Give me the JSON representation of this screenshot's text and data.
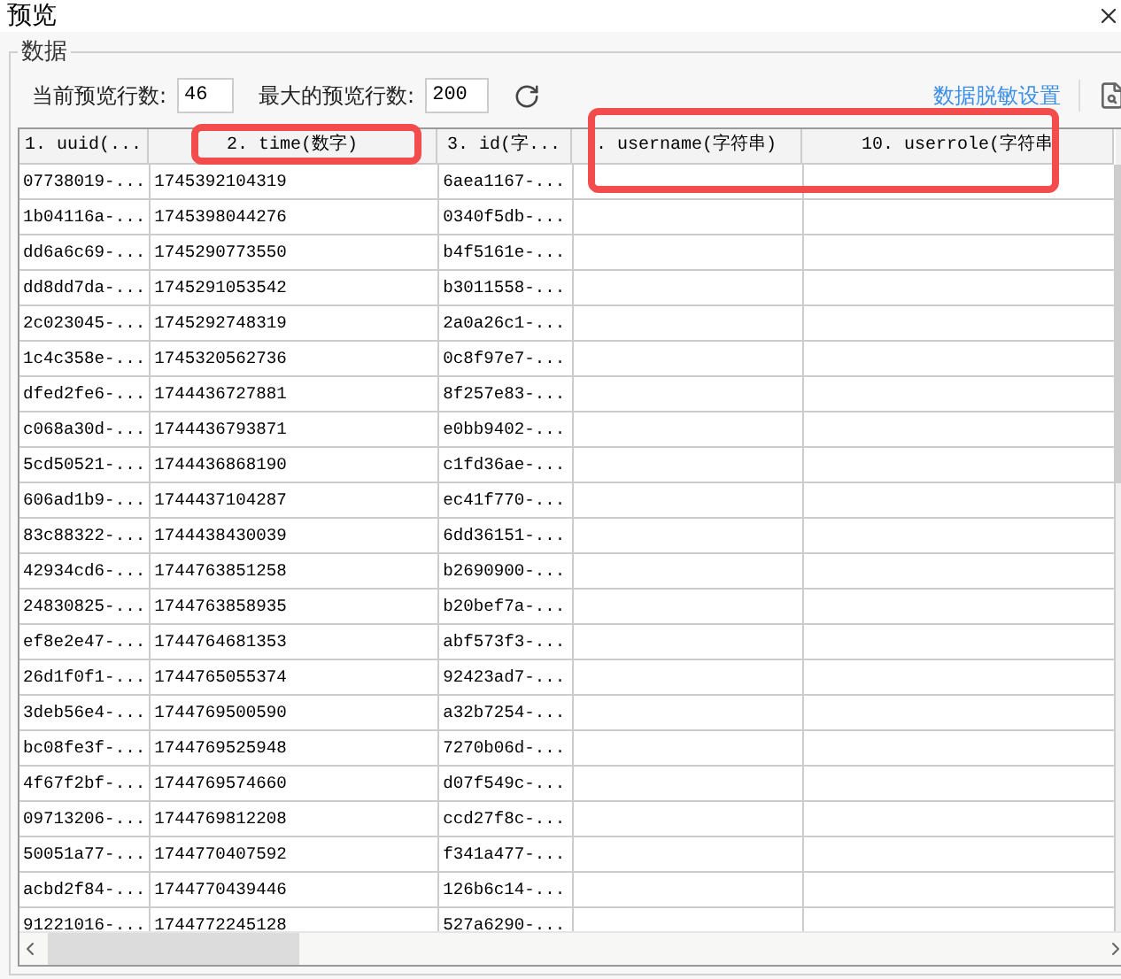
{
  "window": {
    "title": "预览"
  },
  "group": {
    "title": "数据"
  },
  "toolbar": {
    "current_rows_label": "当前预览行数:",
    "current_rows_value": "46",
    "max_rows_label": "最大的预览行数:",
    "max_rows_value": "200",
    "masking_link": "数据脱敏设置"
  },
  "table": {
    "columns": [
      "1. uuid(...",
      "2. time(数字)",
      "3. id(字...",
      ". username(字符串)",
      "10. userrole(字符串"
    ],
    "rows": [
      [
        "07738019-...",
        "1745392104319",
        "6aea1167-..."
      ],
      [
        "1b04116a-...",
        "1745398044276",
        "0340f5db-..."
      ],
      [
        "dd6a6c69-...",
        "1745290773550",
        "b4f5161e-..."
      ],
      [
        "dd8dd7da-...",
        "1745291053542",
        "b3011558-..."
      ],
      [
        "2c023045-...",
        "1745292748319",
        "2a0a26c1-..."
      ],
      [
        "1c4c358e-...",
        "1745320562736",
        "0c8f97e7-..."
      ],
      [
        "dfed2fe6-...",
        "1744436727881",
        "8f257e83-..."
      ],
      [
        "c068a30d-...",
        "1744436793871",
        "e0bb9402-..."
      ],
      [
        "5cd50521-...",
        "1744436868190",
        "c1fd36ae-..."
      ],
      [
        "606ad1b9-...",
        "1744437104287",
        "ec41f770-..."
      ],
      [
        "83c88322-...",
        "1744438430039",
        "6dd36151-..."
      ],
      [
        "42934cd6-...",
        "1744763851258",
        "b2690900-..."
      ],
      [
        "24830825-...",
        "1744763858935",
        "b20bef7a-..."
      ],
      [
        "ef8e2e47-...",
        "1744764681353",
        "abf573f3-..."
      ],
      [
        "26d1f0f1-...",
        "1744765055374",
        "92423ad7-..."
      ],
      [
        "3deb56e4-...",
        "1744769500590",
        "a32b7254-..."
      ],
      [
        "bc08fe3f-...",
        "1744769525948",
        "7270b06d-..."
      ],
      [
        "4f67f2bf-...",
        "1744769574660",
        "d07f549c-..."
      ],
      [
        "09713206-...",
        "1744769812208",
        "ccd27f8c-..."
      ],
      [
        "50051a77-...",
        "1744770407592",
        "f341a477-..."
      ],
      [
        "acbd2f84-...",
        "1744770439446",
        "126b6c14-..."
      ],
      [
        "91221016-...",
        "1744772245128",
        "527a6290-..."
      ]
    ]
  }
}
